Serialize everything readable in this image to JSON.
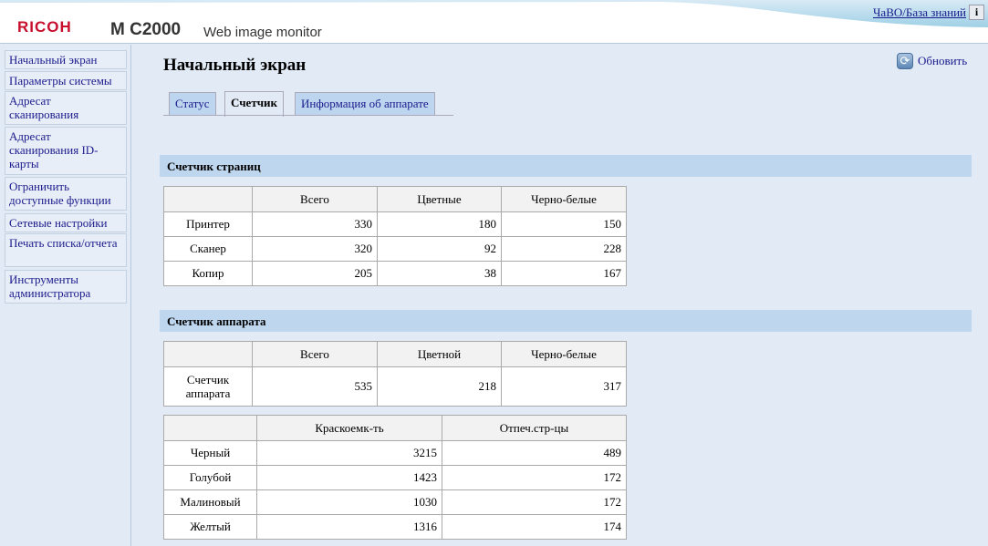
{
  "header": {
    "brand": "RICOH",
    "model": "M C2000",
    "subtitle": "Web image monitor",
    "faq_link": "ЧаВО/База знаний",
    "info_icon": "i"
  },
  "sidebar": {
    "items": [
      {
        "label": "Начальный экран"
      },
      {
        "label": "Параметры системы"
      },
      {
        "label": "Адресат сканирования"
      },
      {
        "label": "Адресат сканирования ID-карты"
      },
      {
        "label": "Ограничить доступные функции"
      },
      {
        "label": "Сетевые настройки"
      },
      {
        "label": "Печать списка/отчета"
      },
      {
        "label": "Инструменты администратора"
      }
    ]
  },
  "main": {
    "title": "Начальный экран",
    "refresh_label": "Обновить",
    "tabs": [
      {
        "label": "Статус"
      },
      {
        "label": "Счетчик",
        "active": true
      },
      {
        "label": "Информация об аппарате"
      }
    ],
    "page_counter": {
      "title": "Счетчик страниц",
      "headers": [
        "",
        "Всего",
        "Цветные",
        "Черно-белые"
      ],
      "rows": [
        [
          "Принтер",
          "330",
          "180",
          "150"
        ],
        [
          "Сканер",
          "320",
          "92",
          "228"
        ],
        [
          "Копир",
          "205",
          "38",
          "167"
        ]
      ]
    },
    "machine_counter": {
      "title": "Счетчик аппарата",
      "headers": [
        "",
        "Всего",
        "Цветной",
        "Черно-белые"
      ],
      "rows": [
        [
          "Счетчик аппарата",
          "535",
          "218",
          "317"
        ]
      ]
    },
    "toner": {
      "headers": [
        "",
        "Краскоемк-ть",
        "Отпеч.стр-цы"
      ],
      "rows": [
        [
          "Черный",
          "3215",
          "489"
        ],
        [
          "Голубой",
          "1423",
          "172"
        ],
        [
          "Малиновый",
          "1030",
          "172"
        ],
        [
          "Желтый",
          "1316",
          "174"
        ]
      ]
    }
  }
}
